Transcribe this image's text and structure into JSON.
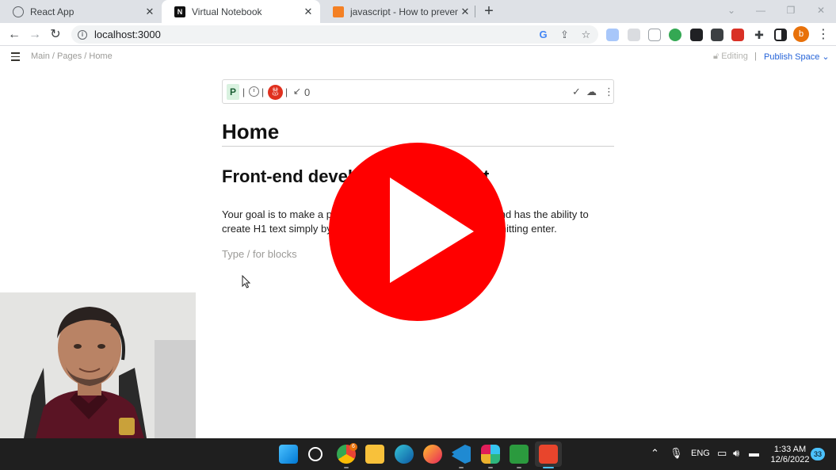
{
  "browser": {
    "tabs": [
      {
        "title": "React App",
        "favicon": "globe-icon",
        "active": false
      },
      {
        "title": "Virtual Notebook",
        "favicon": "notion-icon",
        "active": true
      },
      {
        "title": "javascript - How to prevent Netli",
        "favicon": "stackoverflow-icon",
        "active": false
      }
    ],
    "address": "localhost:3000",
    "profile_initial": "b"
  },
  "page": {
    "breadcrumb": "Main / Pages / Home",
    "editing_label": "Editing",
    "separator": "|",
    "publish_label": "Publish Space",
    "toolbar": {
      "badge": "P",
      "count": "0"
    },
    "title": "Home",
    "section_heading": "Front-end developer test project",
    "paragraph": "Your goal is to make a page that looks exactly like this one, and has the ability to create H1 text simply by typing / then 1, then typing text, and hitting enter.",
    "block_placeholder": "Type / for blocks"
  },
  "taskbar": {
    "language": "ENG",
    "time": "1:33 AM",
    "date": "12/6/2022",
    "notifications": "33",
    "chrome_badge": "6"
  },
  "colors": {
    "accent_link": "#2563d8",
    "play_red": "#ff0000",
    "taskbar_bg": "#1f1f1f"
  }
}
